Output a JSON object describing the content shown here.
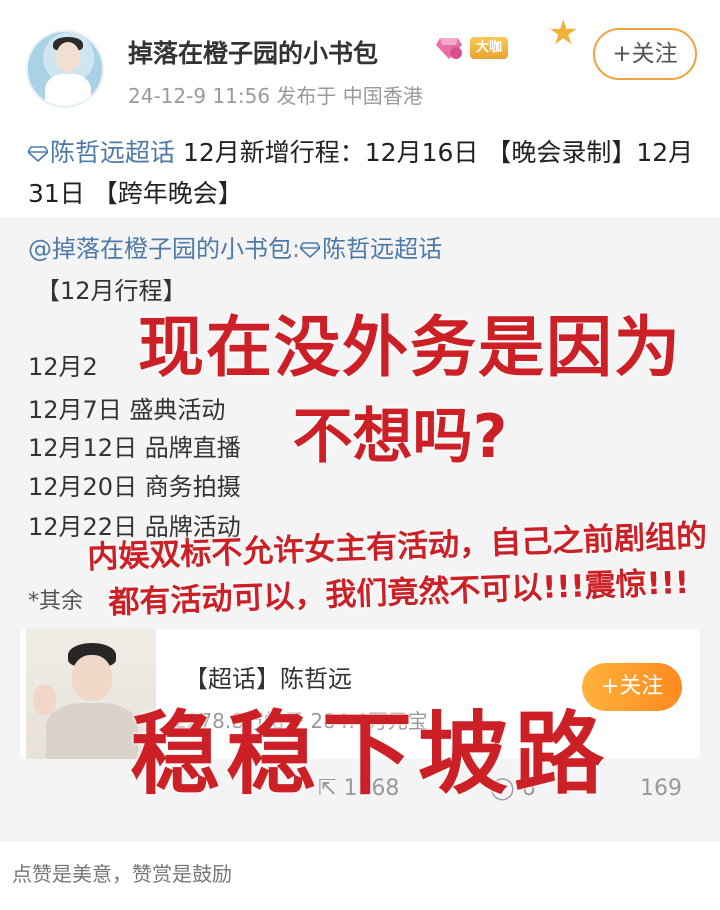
{
  "post": {
    "username": "掉落在橙子园的小书包",
    "level_badge": "大咖",
    "meta": "24-12-9 11:56  发布于 中国香港",
    "follow_label": "+关注",
    "topic": "陈哲远超话",
    "text_after_topic": " 12月新增行程：12月16日 【晚会录制】12月31日 【跨年晚会】"
  },
  "repost": {
    "author": "@掉落在橙子园的小书包",
    "sep": ":",
    "topic": "陈哲远超话",
    "title": "【12月行程】",
    "schedule": [
      "12月2",
      "12月7日 盛典活动",
      "12月12日 品牌直播",
      "12月20日 商务拍摄",
      "12月22日 品牌活动"
    ],
    "note": "*其余",
    "card": {
      "title": "【超话】陈哲远",
      "stats": "2278.8万帖子 284.4万元宝",
      "follow_label": "+关注"
    },
    "actions": {
      "share": "1168",
      "comment": "6",
      "like": "169"
    }
  },
  "overlays": {
    "line1": "现在没外务是因为",
    "line2": "不想吗?",
    "line3": "内娱双标不允许女主有活动，自己之前剧组的都有活动可以，我们竟然不可以!!!震惊!!!",
    "line4": "稳稳下坡路"
  },
  "footer": {
    "text": "点赞是美意，赞赏是鼓励"
  },
  "colors": {
    "accent_orange": "#ff8a1f",
    "link_blue": "#4d7aa8",
    "overlay_red": "#cc1f26"
  }
}
